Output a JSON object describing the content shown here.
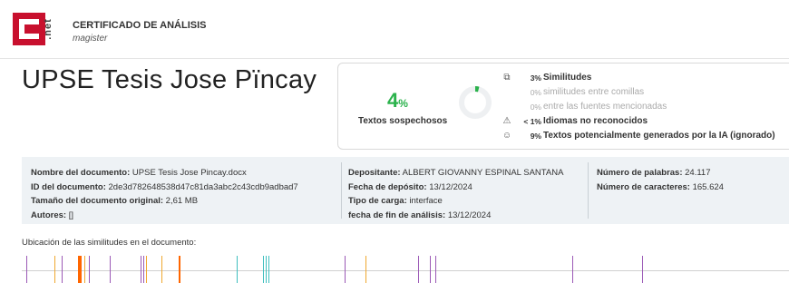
{
  "header": {
    "logo_text": "C.net",
    "title": "CERTIFICADO DE ANÁLISIS",
    "subtitle": "magister"
  },
  "document_title": "UPSE Tesis Jose Pïncay",
  "summary": {
    "suspicious_pct": "4",
    "suspicious_pct_sign": "%",
    "suspicious_label": "Textos sospechosos",
    "suspicious_fraction": 0.04,
    "rows": [
      {
        "icon": "copy-icon",
        "pct": "3%",
        "text": "Similitudes",
        "style": "main"
      },
      {
        "icon": "",
        "pct": "0%",
        "text": "similitudes entre comillas",
        "style": "sub"
      },
      {
        "icon": "",
        "pct": "0%",
        "text": "entre las fuentes mencionadas",
        "style": "sub"
      },
      {
        "icon": "warning-icon",
        "pct": "< 1%",
        "text": "Idiomas no reconocidos",
        "style": "main"
      },
      {
        "icon": "ai-icon",
        "pct": "9%",
        "text": "Textos potencialmente generados por la IA (ignorado)",
        "style": "main"
      }
    ]
  },
  "info": {
    "doc_name_label": "Nombre del documento:",
    "doc_name": "UPSE Tesis Jose Pincay.docx",
    "doc_id_label": "ID del documento:",
    "doc_id": "2de3d782648538d47c81da3abc2c43cdb9adbad7",
    "size_label": "Tamaño del documento original:",
    "size": "2,61 MB",
    "authors_label": "Autores:",
    "authors": "[]",
    "depositor_label": "Depositante:",
    "depositor": "ALBERT GIOVANNY ESPINAL SANTANA",
    "deposit_date_label": "Fecha de depósito:",
    "deposit_date": "13/12/2024",
    "upload_type_label": "Tipo de carga:",
    "upload_type": "interface",
    "analysis_end_label": "fecha de fin de análisis:",
    "analysis_end": "13/12/2024",
    "words_label": "Número de palabras:",
    "words": "24.117",
    "chars_label": "Número de caracteres:",
    "chars": "165.624"
  },
  "location": {
    "label": "Ubicación de las similitudes en el documento:",
    "marks": [
      {
        "pos": 0.006,
        "color": "#9b59b6",
        "w": 1
      },
      {
        "pos": 0.042,
        "color": "#f0a830",
        "w": 1
      },
      {
        "pos": 0.052,
        "color": "#9b59b6",
        "w": 1
      },
      {
        "pos": 0.073,
        "color": "#ff6600",
        "w": 4
      },
      {
        "pos": 0.082,
        "color": "#f0a830",
        "w": 1
      },
      {
        "pos": 0.088,
        "color": "#9b59b6",
        "w": 1
      },
      {
        "pos": 0.115,
        "color": "#9b59b6",
        "w": 1
      },
      {
        "pos": 0.155,
        "color": "#9b59b6",
        "w": 1
      },
      {
        "pos": 0.158,
        "color": "#9b59b6",
        "w": 1
      },
      {
        "pos": 0.162,
        "color": "#f0a830",
        "w": 1
      },
      {
        "pos": 0.182,
        "color": "#f0a830",
        "w": 1
      },
      {
        "pos": 0.205,
        "color": "#ff6600",
        "w": 2
      },
      {
        "pos": 0.28,
        "color": "#3fbfbf",
        "w": 1
      },
      {
        "pos": 0.315,
        "color": "#3fbfbf",
        "w": 1
      },
      {
        "pos": 0.318,
        "color": "#3fbfbf",
        "w": 1
      },
      {
        "pos": 0.321,
        "color": "#3fbfbf",
        "w": 1
      },
      {
        "pos": 0.421,
        "color": "#9b59b6",
        "w": 1
      },
      {
        "pos": 0.448,
        "color": "#f0a830",
        "w": 1
      },
      {
        "pos": 0.516,
        "color": "#9b59b6",
        "w": 1
      },
      {
        "pos": 0.532,
        "color": "#9b59b6",
        "w": 1
      },
      {
        "pos": 0.539,
        "color": "#9b59b6",
        "w": 1
      },
      {
        "pos": 0.717,
        "color": "#9b59b6",
        "w": 1
      },
      {
        "pos": 0.808,
        "color": "#9b59b6",
        "w": 1
      }
    ]
  }
}
